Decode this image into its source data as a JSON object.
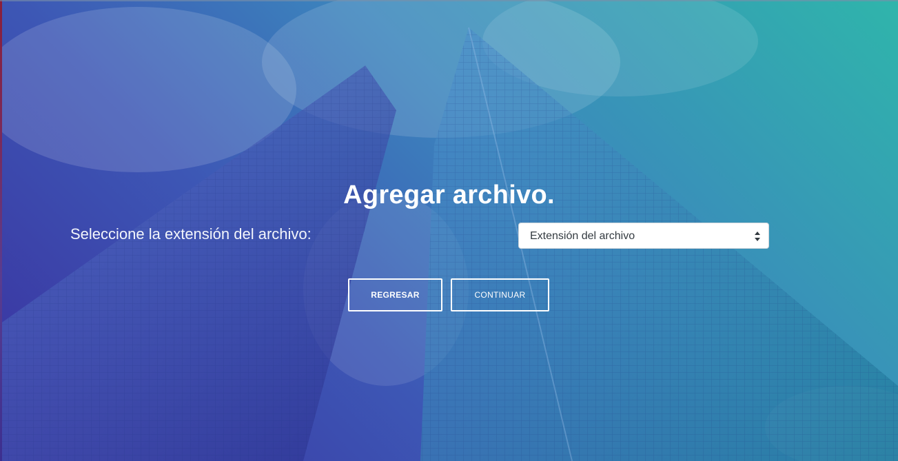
{
  "hero": {
    "title": "Agregar archivo."
  },
  "form": {
    "extension_label": "Seleccione la extensión del archivo:",
    "extension_select": {
      "selected": "Extensión del archivo",
      "icon": "select-arrows-icon"
    }
  },
  "actions": {
    "back_label": "REGRESAR",
    "continue_label": "CONTINUAR"
  },
  "theme": {
    "gradient_start": "#3a2f9e",
    "gradient_end": "#2fb5ab",
    "text": "#ffffff"
  }
}
